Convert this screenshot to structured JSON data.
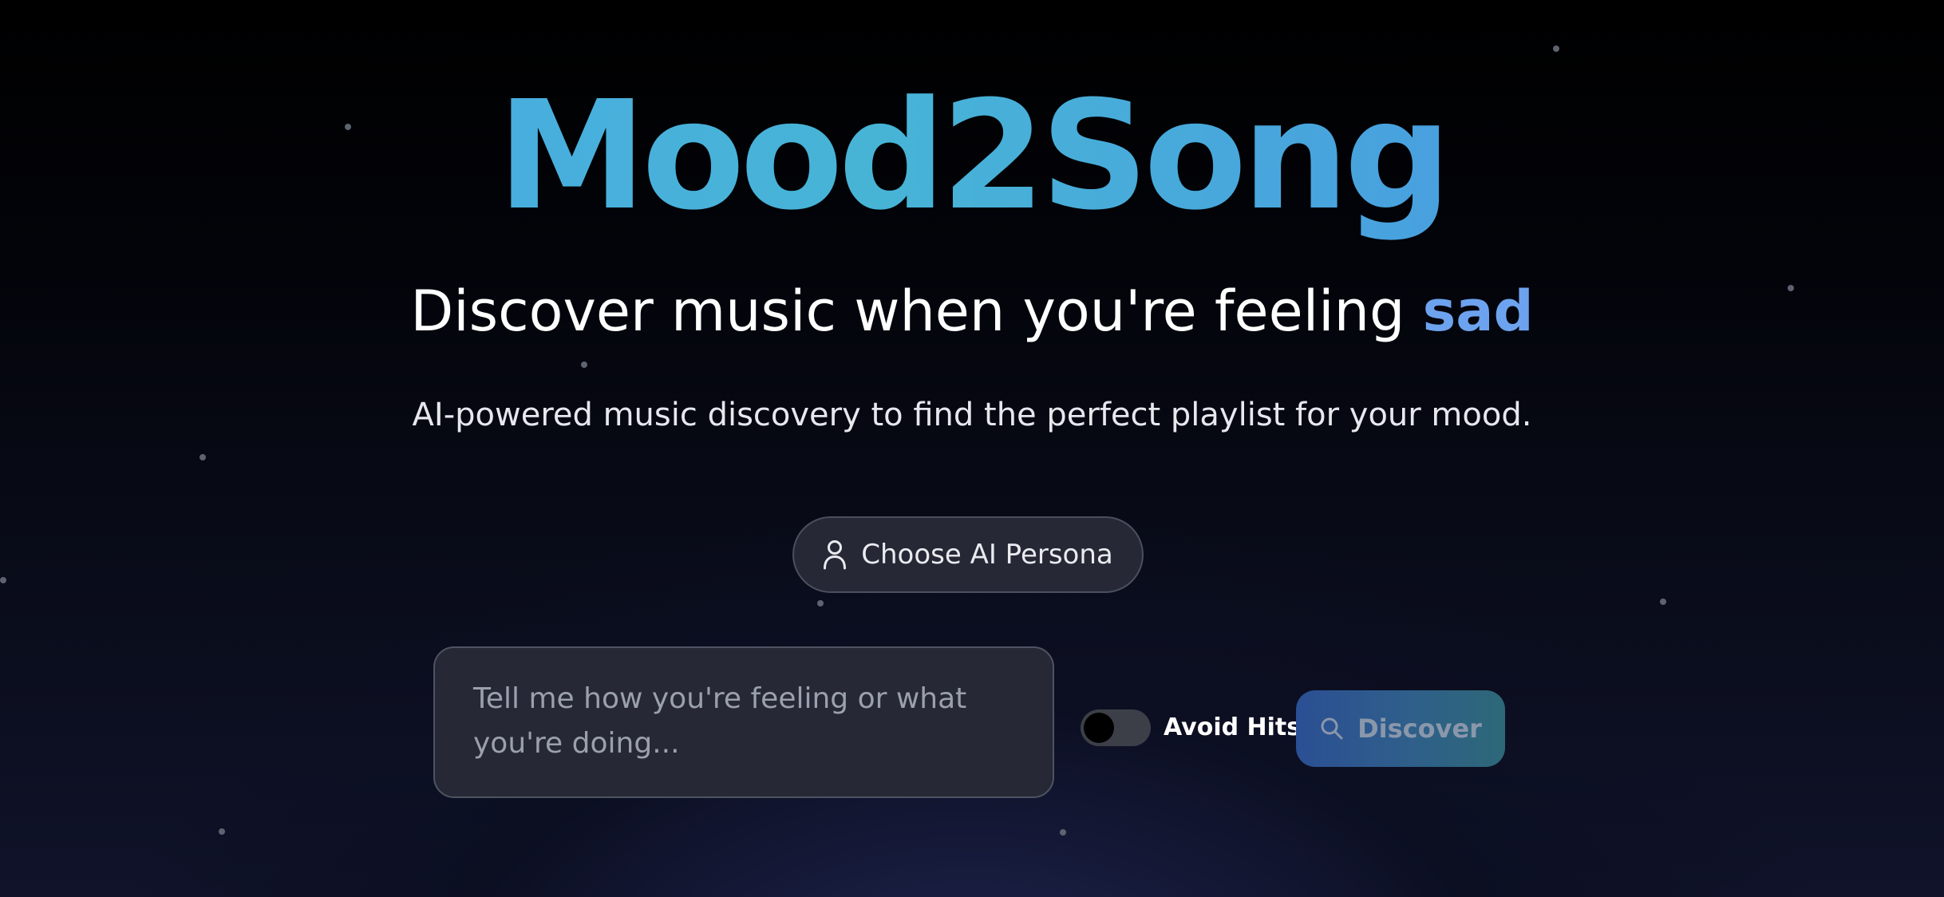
{
  "app": {
    "title": "Mood2Song"
  },
  "hero": {
    "subtitle_prefix": "Discover music when you're feeling ",
    "subtitle_mood": "sad",
    "tagline": "AI-powered music discovery to find the perfect playlist for your mood."
  },
  "persona": {
    "label": "Choose AI Persona",
    "icon": "user-icon"
  },
  "search": {
    "placeholder": "Tell me how you're feeling or what you're doing...",
    "value": ""
  },
  "avoid_hits": {
    "label": "Avoid Hits",
    "enabled": false
  },
  "discover": {
    "label": "Discover",
    "icon": "search-icon"
  },
  "colors": {
    "title_gradient_start": "#4aa6e8",
    "title_gradient_end": "#4a8fe6",
    "mood_accent": "#6da3ee",
    "discover_gradient_start": "#2b4f94",
    "discover_gradient_end": "#2d6878"
  }
}
